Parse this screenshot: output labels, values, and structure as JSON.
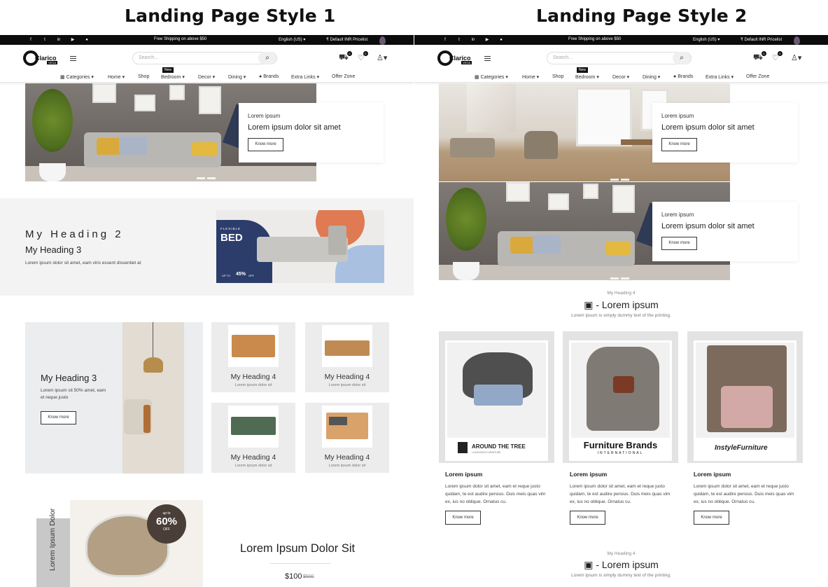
{
  "titles": {
    "left": "Landing Page Style 1",
    "right": "Landing Page Style 2"
  },
  "topbar": {
    "shipping": "Free Shipping on above $50",
    "language": "English (US)",
    "pricelist": "₹ Default INR Pricelist",
    "social_icons": [
      "facebook-icon",
      "twitter-icon",
      "linkedin-icon",
      "youtube-icon",
      "github-icon"
    ]
  },
  "header": {
    "logo": "Clarico",
    "logo_sub": "VEGA",
    "search_placeholder": "Search...",
    "cart_count": "0",
    "wishlist_count": "0"
  },
  "nav": {
    "items": [
      "Categories",
      "Home",
      "Shop",
      "Bedroom",
      "Decor",
      "Dining",
      "Brands",
      "Extra Links",
      "Offer Zone"
    ],
    "new_badge": "New"
  },
  "hero": {
    "small": "Lorem ipsum",
    "large": "Lorem ipsum dolor sit amet",
    "button": "Know more"
  },
  "style1": {
    "banner": {
      "heading2": "My Heading 2",
      "heading3": "My Heading 3",
      "text": "Lorem ipsum dolor sit amet, eam viris essent dissentiet at",
      "promo_line1": "FLEXIBLE",
      "promo_line2": "BED",
      "promo_line3": "UP TO",
      "promo_pct": "45%",
      "promo_off": "OFF"
    },
    "feature": {
      "heading3": "My Heading 3",
      "text": "Lorem ipsum sit 50% amet, eam et reque justo",
      "button": "Know more"
    },
    "tiles": [
      {
        "heading": "My Heading 4",
        "sub": "Lorem ipsum dolor sit"
      },
      {
        "heading": "My Heading 4",
        "sub": "Lorem ipsum dolor sit"
      },
      {
        "heading": "My Heading 4",
        "sub": "Lorem ipsum dolor sit"
      },
      {
        "heading": "My Heading 4",
        "sub": "Lorem ipsum dolor sit"
      }
    ],
    "deal": {
      "vertical": "Lorem Ipsum Dolor",
      "up_to": "up to",
      "pct": "60%",
      "off": "OFF",
      "title": "Lorem Ipsum Dolor Sit",
      "price": "$100",
      "old_price": "$500"
    }
  },
  "style2": {
    "section1": {
      "heading4": "My Heading 4",
      "title": "- Lorem ipsum",
      "sub": "Lorem ipsum is simply dummy text of the printing."
    },
    "brands": [
      {
        "brand": "AROUND THE TREE",
        "brand_sub": "LUXURIOUS FURNITURE",
        "title": "Lorem ipsum",
        "desc": "Lorem ipsum dolor sit amet, eam et reque justo quidam, te est audire persius. Duis meis quas vim ex, ius no oblique. Ornatus cu.",
        "button": "Know more"
      },
      {
        "brand": "Furniture Brands",
        "brand_sub": "INTERNATIONAL",
        "title": "Lorem ipsum",
        "desc": "Lorem ipsum dolor sit amet, eam et reque justo quidam, te est audire persius. Duis meis quas vim ex, ius no oblique. Ornatus cu.",
        "button": "Know more"
      },
      {
        "brand": "InstyleFurniture",
        "brand_sub": "",
        "title": "Lorem ipsum",
        "desc": "Lorem ipsum dolor sit amet, eam et reque justo quidam, te est audire persius. Duis meis quas vim ex, ius no oblique. Ornatus cu.",
        "button": "Know more"
      }
    ],
    "section2": {
      "heading4": "My Heading 4",
      "title": "- Lorem ipsum",
      "sub": "Lorem ipsum is simply dummy text of the printing."
    }
  },
  "colors": {
    "dark": "#0c0c0c",
    "panel": "#f3f3f3",
    "promo_navy": "#2c3d6b",
    "promo_orange": "#e07a53"
  }
}
